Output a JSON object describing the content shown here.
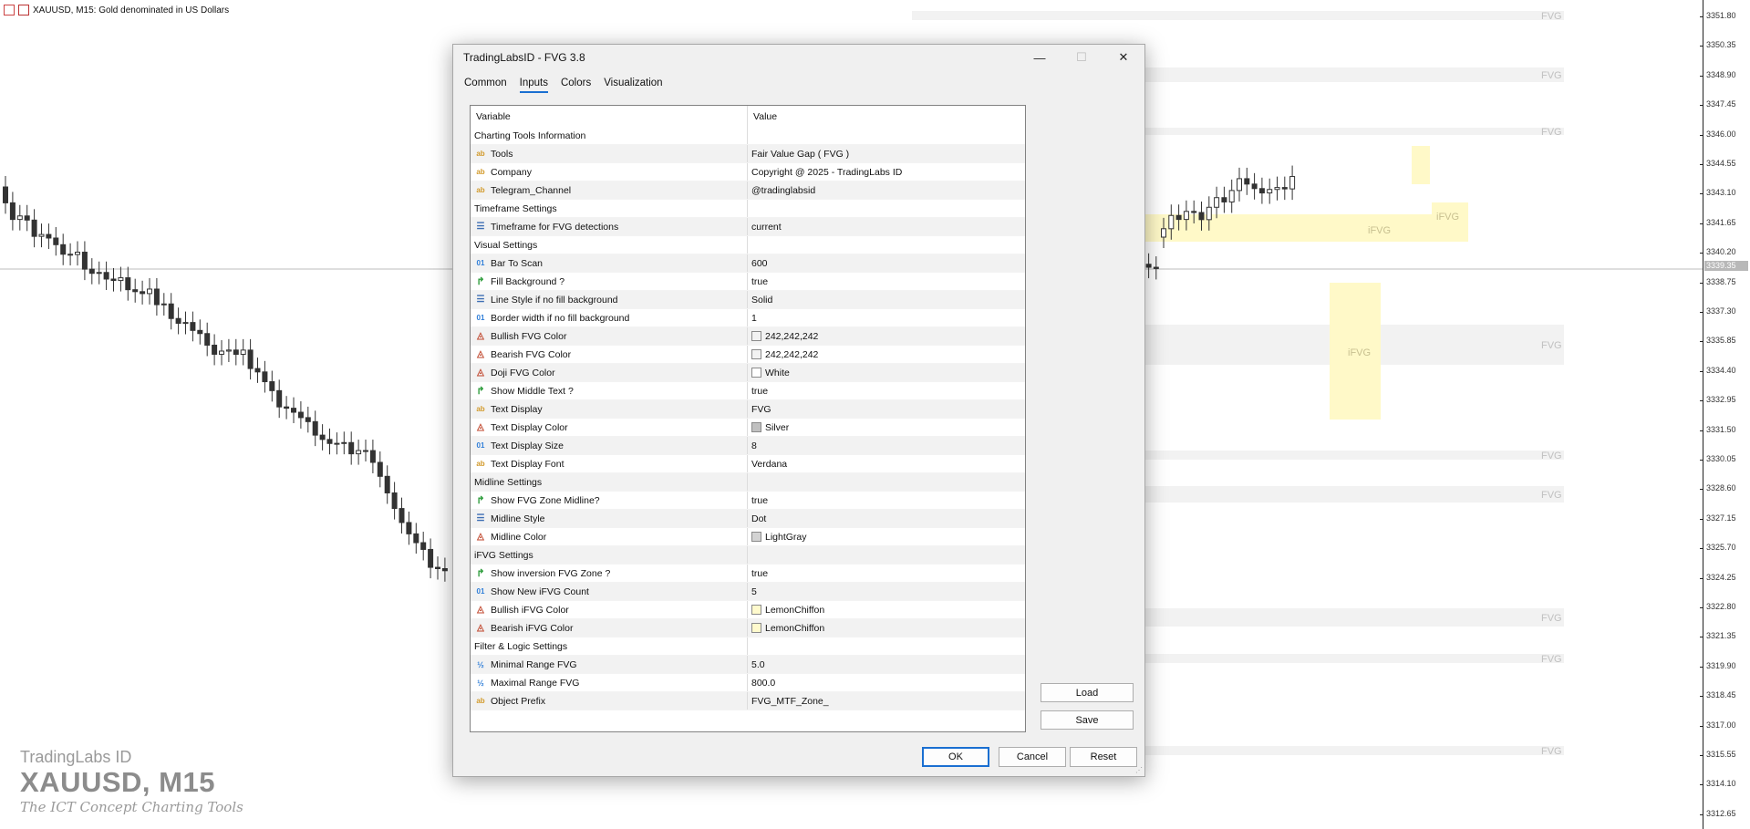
{
  "chart": {
    "symbol_title": "XAUUSD, M15:  Gold denominated in US Dollars",
    "price_labels": [
      "3351.80",
      "3350.35",
      "3348.90",
      "3347.45",
      "3346.00",
      "3344.55",
      "3343.10",
      "3341.65",
      "3340.20",
      "3338.75",
      "3337.30",
      "3335.85",
      "3334.40",
      "3332.95",
      "3331.50",
      "3330.05",
      "3328.60",
      "3327.15",
      "3325.70",
      "3324.25",
      "3322.80",
      "3321.35",
      "3319.90",
      "3318.45",
      "3317.00",
      "3315.55",
      "3314.10",
      "3312.65"
    ],
    "current_price": "3339.35",
    "zone_label": "FVG",
    "inversion_label": "iFVG",
    "watermark": {
      "brand": "TradingLabs ID",
      "symbol": "XAUUSD, M15",
      "tagline": "The ICT Concept Charting Tools"
    },
    "colors": {
      "zone_fill": "#f2f2f2",
      "zone_text": "#c0c0c0",
      "ifvg_fill": "#fff9c8",
      "candle": "#333333",
      "crosshair": "#bcbcbc"
    }
  },
  "dialog": {
    "title": "TradingLabsID - FVG 3.8",
    "window_buttons": {
      "minimize": "—",
      "maximize": "☐",
      "close": "✕"
    },
    "tabs": [
      {
        "label": "Common",
        "active": false
      },
      {
        "label": "Inputs",
        "active": true
      },
      {
        "label": "Colors",
        "active": false
      },
      {
        "label": "Visualization",
        "active": false
      }
    ],
    "grid_headers": {
      "variable": "Variable",
      "value": "Value"
    },
    "rows": [
      {
        "kind": "group",
        "variable": "Charting Tools Information",
        "value": ""
      },
      {
        "kind": "ab",
        "variable": "Tools",
        "value": "Fair Value Gap ( FVG )"
      },
      {
        "kind": "ab",
        "variable": "Company",
        "value": "Copyright @ 2025 - TradingLabs ID"
      },
      {
        "kind": "ab",
        "variable": "Telegram_Channel",
        "value": "@tradinglabsid"
      },
      {
        "kind": "group",
        "variable": "Timeframe Settings",
        "value": ""
      },
      {
        "kind": "enum",
        "variable": "Timeframe for FVG detections",
        "value": "current"
      },
      {
        "kind": "group",
        "variable": "Visual Settings",
        "value": ""
      },
      {
        "kind": "n01",
        "variable": "Bar To Scan",
        "value": "600"
      },
      {
        "kind": "bool",
        "variable": "Fill Background ?",
        "value": "true"
      },
      {
        "kind": "enum",
        "variable": "Line Style if no fill background",
        "value": "Solid"
      },
      {
        "kind": "n01",
        "variable": "Border width if no fill background",
        "value": "1"
      },
      {
        "kind": "pal",
        "variable": "Bullish FVG Color",
        "value": "242,242,242",
        "swatch": "#f2f2f2"
      },
      {
        "kind": "pal",
        "variable": "Bearish FVG Color",
        "value": "242,242,242",
        "swatch": "#f2f2f2"
      },
      {
        "kind": "pal",
        "variable": "Doji FVG Color",
        "value": "White",
        "swatch": "#ffffff"
      },
      {
        "kind": "bool",
        "variable": "Show Middle Text ?",
        "value": "true"
      },
      {
        "kind": "ab",
        "variable": "Text Display",
        "value": "FVG"
      },
      {
        "kind": "pal",
        "variable": "Text Display Color",
        "value": "Silver",
        "swatch": "#c0c0c0"
      },
      {
        "kind": "n01",
        "variable": "Text Display Size",
        "value": "8"
      },
      {
        "kind": "ab",
        "variable": "Text Display Font",
        "value": "Verdana"
      },
      {
        "kind": "group",
        "variable": "Midline Settings",
        "value": ""
      },
      {
        "kind": "bool",
        "variable": "Show FVG Zone Midline?",
        "value": "true"
      },
      {
        "kind": "enum",
        "variable": "Midline Style",
        "value": "Dot"
      },
      {
        "kind": "pal",
        "variable": "Midline Color",
        "value": "LightGray",
        "swatch": "#d3d3d3"
      },
      {
        "kind": "group",
        "variable": "iFVG Settings",
        "value": ""
      },
      {
        "kind": "bool",
        "variable": "Show inversion FVG Zone ?",
        "value": "true"
      },
      {
        "kind": "n01",
        "variable": "Show New iFVG Count",
        "value": "5"
      },
      {
        "kind": "pal",
        "variable": "Bullish iFVG Color",
        "value": "LemonChiffon",
        "swatch": "#fffacd"
      },
      {
        "kind": "pal",
        "variable": "Bearish iFVG Color",
        "value": "LemonChiffon",
        "swatch": "#fffacd"
      },
      {
        "kind": "group",
        "variable": "Filter & Logic Settings",
        "value": ""
      },
      {
        "kind": "dbl",
        "variable": "Minimal Range FVG",
        "value": "5.0"
      },
      {
        "kind": "dbl",
        "variable": "Maximal Range FVG",
        "value": "800.0"
      },
      {
        "kind": "ab",
        "variable": "Object Prefix",
        "value": "FVG_MTF_Zone_"
      }
    ],
    "type_icons": {
      "ab": "ab",
      "n01": "01",
      "bool": "↱",
      "pal": "◬",
      "enum": "☰",
      "dbl": "½"
    },
    "side_buttons": {
      "load": "Load",
      "save": "Save"
    },
    "footer_buttons": {
      "ok": "OK",
      "cancel": "Cancel",
      "reset": "Reset"
    }
  }
}
